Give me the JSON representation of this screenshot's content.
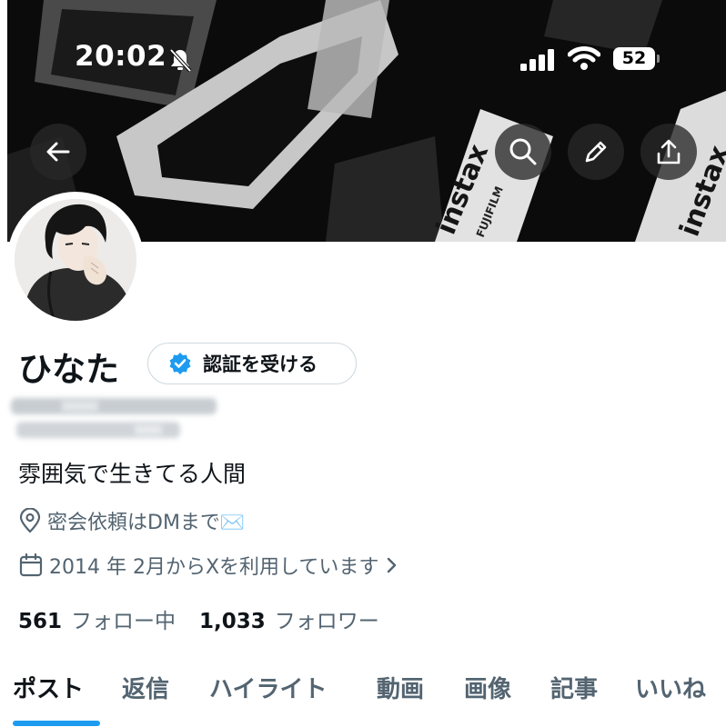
{
  "status_bar": {
    "time": "20:02",
    "battery": "52",
    "icons": [
      "bell-muted-icon",
      "signal-icon",
      "wifi-icon",
      "battery-icon"
    ]
  },
  "banner": {
    "film_brand": "instax",
    "film_sub": "FUJIFILM",
    "film_brand_2": "instax"
  },
  "header_actions": [
    "back-arrow-icon",
    "search-icon",
    "pencil-icon",
    "share-icon"
  ],
  "profile": {
    "display_name": "ひなた",
    "verify_label": "認証を受ける",
    "bio": "雰囲気で生きてる人間",
    "location": "密会依頼はDMまで✉️",
    "joined": "2014 年 2月からXを利用しています",
    "following_count": "561",
    "following_label": "フォロー中",
    "followers_count": "1,033",
    "followers_label": "フォロワー"
  },
  "tabs": [
    {
      "label": "ポスト",
      "active": true
    },
    {
      "label": "返信",
      "active": false
    },
    {
      "label": "ハイライト",
      "active": false
    },
    {
      "label": "動画",
      "active": false
    },
    {
      "label": "画像",
      "active": false
    },
    {
      "label": "記事",
      "active": false
    },
    {
      "label": "いいね",
      "active": false
    }
  ],
  "colors": {
    "accent": "#1d9bf0",
    "text_primary": "#0f1419",
    "text_secondary": "#536471",
    "verified_badge": "#1d9bf0"
  }
}
